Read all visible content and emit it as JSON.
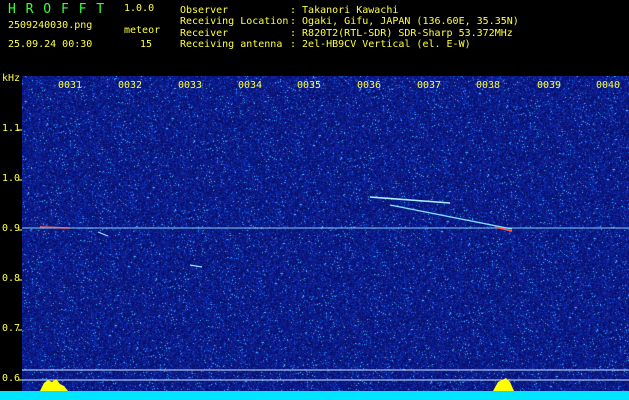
{
  "header": {
    "app_name": "H R O F F T",
    "version": "1.0.0",
    "filename": "2509240030.png",
    "datetime": "25.09.24 00:30",
    "meteor_label": "meteor",
    "meteor_count": "15",
    "info": [
      {
        "label": "Observer",
        "value": ": Takanori Kawachi"
      },
      {
        "label": "Receiving Location",
        "value": ": Ogaki, Gifu, JAPAN (136.60E, 35.35N)"
      },
      {
        "label": "Receiver",
        "value": ": R820T2(RTL-SDR) SDR-Sharp 53.372MHz"
      },
      {
        "label": "Receiving antenna",
        "value": ": 2el-HB9CV Vertical (el. E-W)"
      }
    ]
  },
  "axis": {
    "unit": "kHz",
    "y_ticks": [
      "1.1",
      "1.0",
      "0.9",
      "0.8",
      "0.7",
      "0.6"
    ],
    "x_ticks": [
      "0031",
      "0032",
      "0033",
      "0034",
      "0035",
      "0036",
      "0037",
      "0038",
      "0039",
      "0040"
    ]
  },
  "colors": {
    "background": "#000000",
    "spectrum_bg": "#0c1a8a",
    "header_green": "#3bff3b",
    "header_yellow": "#ffff40",
    "meteor_trace": "#7fe0ff",
    "noise_bar": "#00e5ff",
    "peak_yellow": "#ffff00"
  }
}
